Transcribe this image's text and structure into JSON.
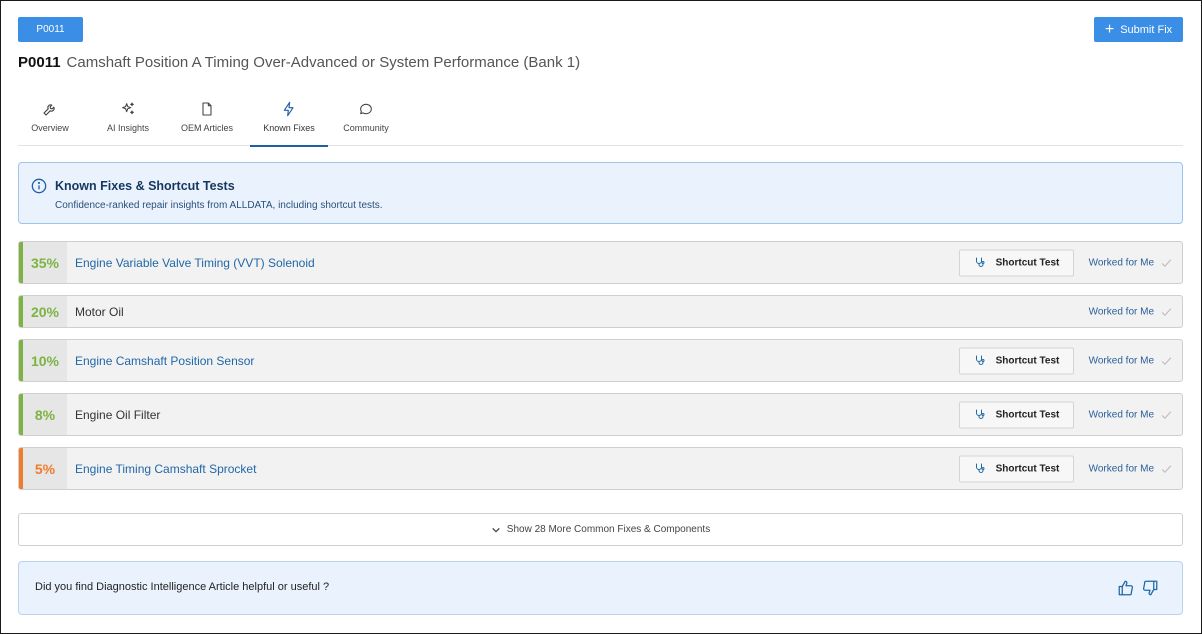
{
  "header": {
    "code_button": "P0011",
    "submit_label": "Submit Fix",
    "code": "P0011",
    "title": "Camshaft Position A Timing Over-Advanced or System Performance (Bank 1)"
  },
  "tabs": [
    {
      "label": "Overview",
      "icon": "wrench-icon"
    },
    {
      "label": "AI Insights",
      "icon": "sparkle-icon"
    },
    {
      "label": "OEM Articles",
      "icon": "document-icon"
    },
    {
      "label": "Known Fixes",
      "icon": "lightning-icon",
      "active": true
    },
    {
      "label": "Community",
      "icon": "chat-icon"
    }
  ],
  "info": {
    "title": "Known Fixes & Shortcut Tests",
    "subtitle": "Confidence-ranked repair insights from ALLDATA, including shortcut tests."
  },
  "fixes": [
    {
      "percent": "35%",
      "name": "Engine Variable Valve Timing (VVT) Solenoid",
      "link": true,
      "shortcut": true,
      "color": "#7cb342"
    },
    {
      "percent": "20%",
      "name": "Motor Oil",
      "link": false,
      "shortcut": false,
      "color": "#7cb342"
    },
    {
      "percent": "10%",
      "name": "Engine Camshaft Position Sensor",
      "link": true,
      "shortcut": true,
      "color": "#7cb342"
    },
    {
      "percent": "8%",
      "name": "Engine Oil Filter",
      "link": false,
      "shortcut": true,
      "color": "#7cb342"
    },
    {
      "percent": "5%",
      "name": "Engine Timing Camshaft Sprocket",
      "link": true,
      "shortcut": true,
      "color": "#ef7d2b"
    }
  ],
  "shortcut_label": "Shortcut Test",
  "worked_label": "Worked for Me",
  "more_label": "Show 28 More Common Fixes & Components",
  "feedback": {
    "question": "Did you find Diagnostic Intelligence Article helpful or useful ?"
  },
  "colors": {
    "primary": "#3a8ee6",
    "link": "#2068a8",
    "green": "#7cb342",
    "orange": "#ef7d2b",
    "tab_active": "#1f5fa8"
  }
}
